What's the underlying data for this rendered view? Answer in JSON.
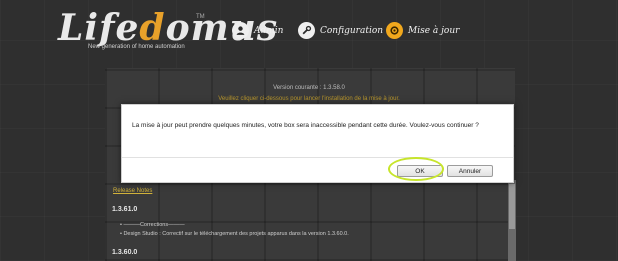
{
  "header": {
    "logo_prefix": "Life",
    "logo_a": "d",
    "logo_suffix": "omus",
    "trademark": "TM",
    "tagline": "New generation of home automation",
    "nav": [
      {
        "label": "Admin",
        "icon": "user-icon"
      },
      {
        "label": "Configuration",
        "icon": "wrench-icon"
      },
      {
        "label": "Mise à jour",
        "icon": "update-icon"
      }
    ]
  },
  "panel": {
    "version": "Version courante : 1.3.58.0",
    "hint": "Veuillez cliquer ci-dessous pour lancer l'installation de la mise à jour.",
    "release_link": "Release Notes",
    "releases": [
      {
        "version": "1.3.61.0"
      },
      {
        "version": "1.3.60.0"
      }
    ],
    "notes": [
      "• ———Corrections———",
      "• Design Studio : Correctif sur le téléchargement des projets apparus dans la version 1.3.60.0."
    ]
  },
  "modal": {
    "message": "La mise à jour peut prendre quelques minutes, votre box sera inaccessible pendant cette durée. Voulez-vous continuer ?",
    "ok_label": "OK",
    "cancel_label": "Annuler"
  },
  "colors": {
    "accent": "#e8a12a",
    "highlight": "#c7e52b"
  }
}
